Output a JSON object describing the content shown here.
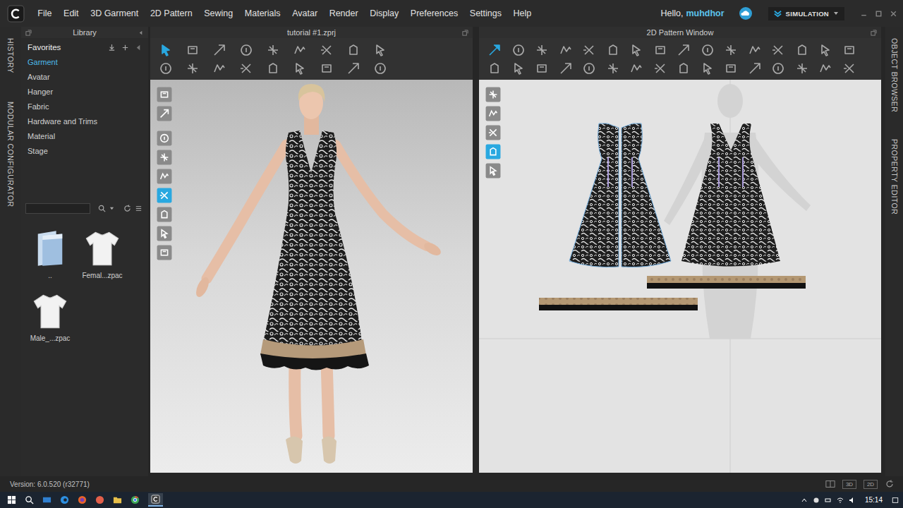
{
  "menubar": {
    "items": [
      "File",
      "Edit",
      "3D Garment",
      "2D Pattern",
      "Sewing",
      "Materials",
      "Avatar",
      "Render",
      "Display",
      "Preferences",
      "Settings",
      "Help"
    ],
    "greeting": "Hello,",
    "user": "muhdhor",
    "mode": "SIMULATION"
  },
  "side_tabs_left": [
    "HISTORY",
    "MODULAR CONFIGURATOR"
  ],
  "side_tabs_right": [
    "OBJECT BROWSER",
    "PROPERTY EDITOR"
  ],
  "library": {
    "title": "Library",
    "section": "Favorites",
    "items": [
      {
        "label": "Garment",
        "selected": true
      },
      {
        "label": "Avatar",
        "selected": false
      },
      {
        "label": "Hanger",
        "selected": false
      },
      {
        "label": "Fabric",
        "selected": false
      },
      {
        "label": "Hardware and Trims",
        "selected": false
      },
      {
        "label": "Material",
        "selected": false
      },
      {
        "label": "Stage",
        "selected": false
      }
    ],
    "search": {
      "placeholder": ""
    },
    "files": [
      {
        "name": "..",
        "kind": "folder"
      },
      {
        "name": "Femal...zpac",
        "kind": "garment"
      },
      {
        "name": "Male_...zpac",
        "kind": "garment"
      }
    ]
  },
  "window_3d": {
    "title": "tutorial #1.zprj",
    "tools": [
      [
        true,
        false,
        false,
        false,
        false,
        false,
        false,
        false,
        false
      ],
      [
        false,
        false,
        false,
        false,
        false,
        false,
        false,
        false,
        false
      ]
    ],
    "view_tools": [
      false,
      false,
      false,
      false,
      false,
      true,
      false,
      false,
      false
    ]
  },
  "window_2d": {
    "title": "2D Pattern Window",
    "tools": [
      [
        true,
        false,
        false,
        false,
        false,
        false,
        false,
        false,
        false,
        false,
        false,
        false,
        false,
        false,
        false,
        false
      ],
      [
        false,
        false,
        false,
        false,
        false,
        false,
        false,
        false,
        false,
        false,
        false,
        false,
        false,
        false,
        false,
        false
      ]
    ],
    "view_tools": [
      false,
      false,
      false,
      true,
      false
    ]
  },
  "status_bar": {
    "version": "Version: 6.0.520 (r32771)",
    "views": [
      "3D",
      "2D"
    ]
  },
  "taskbar": {
    "time": "15:14"
  }
}
